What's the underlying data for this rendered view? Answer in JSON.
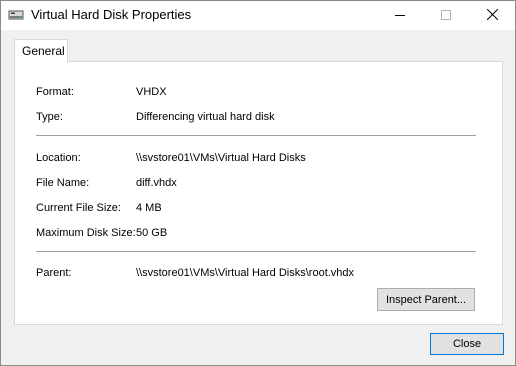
{
  "window": {
    "title": "Virtual Hard Disk Properties"
  },
  "titlebar_icons": {
    "app": "disk-drive-icon",
    "minimize": "minimize-icon",
    "maximize": "maximize-icon",
    "close": "close-icon"
  },
  "tabs": [
    {
      "label": "General",
      "selected": true
    }
  ],
  "properties": {
    "format": {
      "label": "Format:",
      "value": "VHDX"
    },
    "type": {
      "label": "Type:",
      "value": "Differencing virtual hard disk"
    },
    "location": {
      "label": "Location:",
      "value": "\\\\svstore01\\VMs\\Virtual Hard Disks"
    },
    "file_name": {
      "label": "File Name:",
      "value": "diff.vhdx"
    },
    "current_file_size": {
      "label": "Current File Size:",
      "value": "4 MB"
    },
    "maximum_disk_size": {
      "label": "Maximum Disk Size:",
      "value": "50 GB"
    },
    "parent": {
      "label": "Parent:",
      "value": "\\\\svstore01\\VMs\\Virtual Hard Disks\\root.vhdx"
    }
  },
  "buttons": {
    "inspect_parent": "Inspect Parent...",
    "close": "Close"
  }
}
